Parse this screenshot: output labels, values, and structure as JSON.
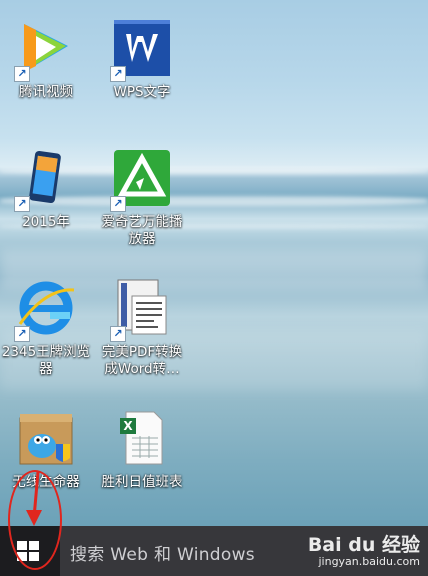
{
  "desktop": {
    "icons": [
      {
        "label": "腾讯视频",
        "icon": "tencent-video-icon"
      },
      {
        "label": "WPS文字",
        "icon": "wps-writer-icon"
      },
      {
        "label": "2015年",
        "icon": "phone-icon"
      },
      {
        "label": "爱奇艺万能播放器",
        "icon": "iqiyi-player-icon"
      },
      {
        "label": "2345王牌浏览器",
        "icon": "ie-browser-icon"
      },
      {
        "label": "完美PDF转换成Word转…",
        "icon": "pdf-converter-icon"
      },
      {
        "label": "无线生命器",
        "icon": "wifi-bird-box-icon"
      },
      {
        "label": "胜利日值班表",
        "icon": "excel-icon"
      }
    ]
  },
  "taskbar": {
    "search_placeholder": "搜索 Web 和 Windows"
  },
  "watermark": {
    "logo": "Bai du 经验",
    "url": "jingyan.baidu.com"
  },
  "colors": {
    "taskbar": "#1c1c1f",
    "search_box": "#37373b",
    "annotation": "#e0261e"
  }
}
